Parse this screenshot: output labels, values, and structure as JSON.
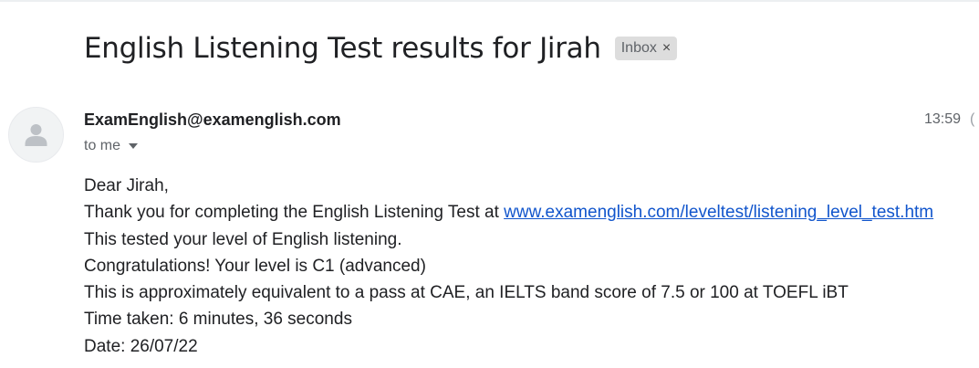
{
  "email": {
    "subject": "English Listening Test results for Jirah",
    "label": {
      "text": "Inbox",
      "close_symbol": "×"
    },
    "sender": "ExamEnglish@examenglish.com",
    "recipient": "to me",
    "time": "13:59",
    "time_cutoff": "(",
    "body": {
      "greeting": "Dear Jirah,",
      "line1_prefix": "Thank you for completing the English Listening Test at ",
      "line1_link": "www.examenglish.com/leveltest/listening_level_test.htm",
      "line2": "This tested your level of English listening.",
      "line3": "Congratulations! Your level is C1 (advanced)",
      "line4": "This is approximately equivalent to a pass at CAE, an IELTS band score of 7.5 or 100 at TOEFL iBT",
      "line5": "Time taken: 6 minutes, 36 seconds",
      "line6": "Date: 26/07/22"
    }
  },
  "colors": {
    "link": "#1155cc",
    "text": "#202124",
    "muted": "#5f6368",
    "chip_background": "#dddddd"
  },
  "icons": {
    "avatar": "person-silhouette-icon",
    "chip_close": "close-icon",
    "recipient_details": "chevron-down-icon"
  }
}
